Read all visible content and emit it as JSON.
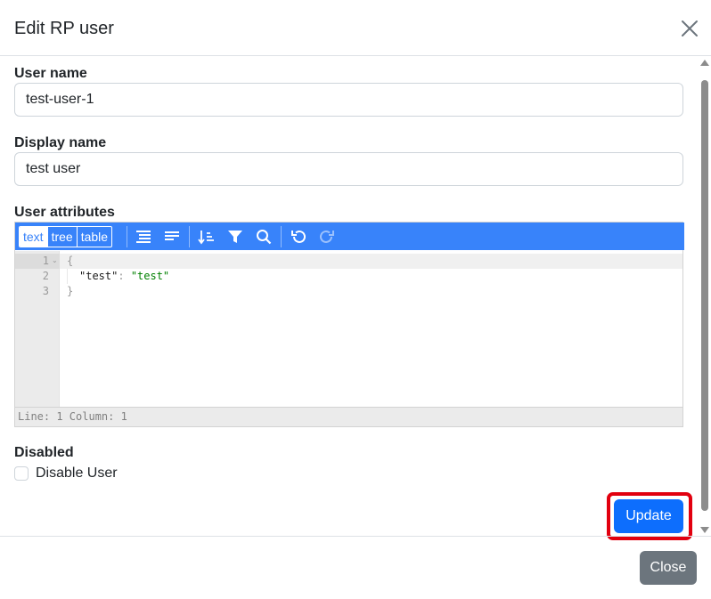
{
  "modal": {
    "title": "Edit RP user"
  },
  "form": {
    "username": {
      "label": "User name",
      "value": "test-user-1"
    },
    "display_name": {
      "label": "Display name",
      "value": "test user"
    },
    "attributes": {
      "label": "User attributes",
      "modes": [
        "text",
        "tree",
        "table"
      ],
      "active_mode": "text",
      "toolbar_icons": [
        "format-icon",
        "compact-icon",
        "sort-icon",
        "filter-icon",
        "search-icon",
        "undo-icon",
        "redo-icon"
      ],
      "line_numbers": [
        "1",
        "2",
        "3"
      ],
      "code": {
        "open": "{",
        "key": "\"test\"",
        "colon": ": ",
        "value": "\"test\"",
        "close": "}"
      },
      "status": "Line: 1  Column: 1"
    },
    "disabled": {
      "label": "Disabled",
      "checkbox_label": "Disable User",
      "checked": false
    }
  },
  "buttons": {
    "update": "Update",
    "close": "Close"
  },
  "colors": {
    "primary": "#0d6efd",
    "editor_accent": "#3883fa",
    "secondary": "#6c757d",
    "highlight": "#e2000f"
  }
}
